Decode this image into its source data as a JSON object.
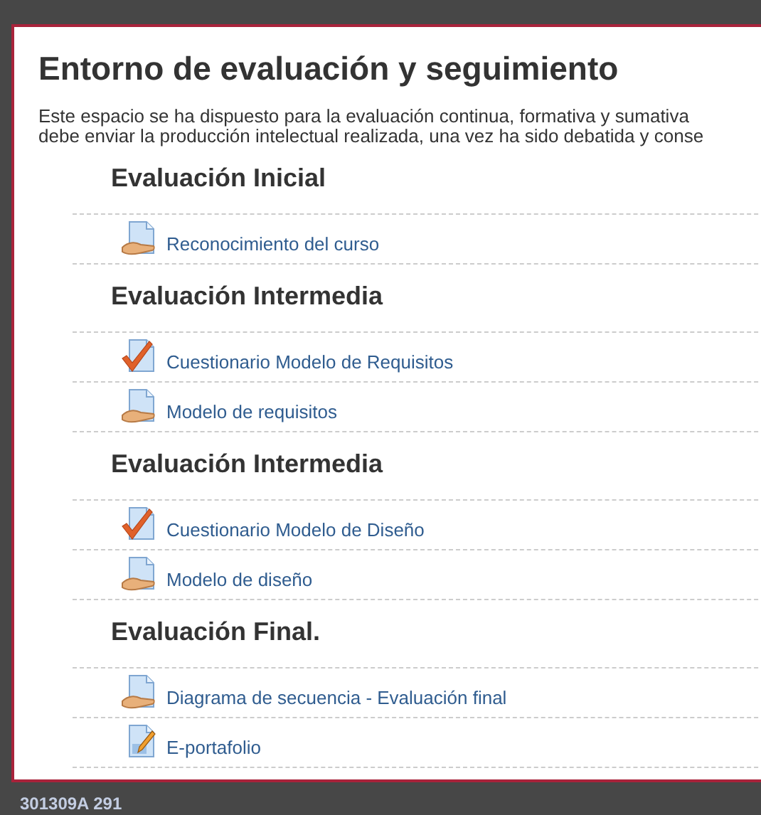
{
  "dialog": {
    "title": "Entorno de evaluación y seguimiento",
    "description_lines": [
      "Este espacio se ha dispuesto para la evaluación continua, formativa y sumativa",
      "debe enviar la producción intelectual realizada, una vez ha sido debatida y conse"
    ],
    "sections": [
      {
        "heading": "Evaluación Inicial",
        "items": [
          {
            "kind": "resource",
            "label": "Reconocimiento del curso"
          }
        ]
      },
      {
        "heading": "Evaluación Intermedia",
        "items": [
          {
            "kind": "quiz",
            "label": "Cuestionario Modelo de Requisitos"
          },
          {
            "kind": "resource",
            "label": "Modelo de requisitos"
          }
        ]
      },
      {
        "heading": "Evaluación Intermedia",
        "items": [
          {
            "kind": "quiz",
            "label": "Cuestionario Modelo de Diseño"
          },
          {
            "kind": "resource",
            "label": "Modelo de diseño"
          }
        ]
      },
      {
        "heading": "Evaluación Final.",
        "items": [
          {
            "kind": "resource",
            "label": "Diagrama de secuencia - Evaluación final"
          },
          {
            "kind": "assignment",
            "label": "E-portafolio"
          }
        ]
      }
    ]
  },
  "background": {
    "course_code": "301309A  291"
  }
}
